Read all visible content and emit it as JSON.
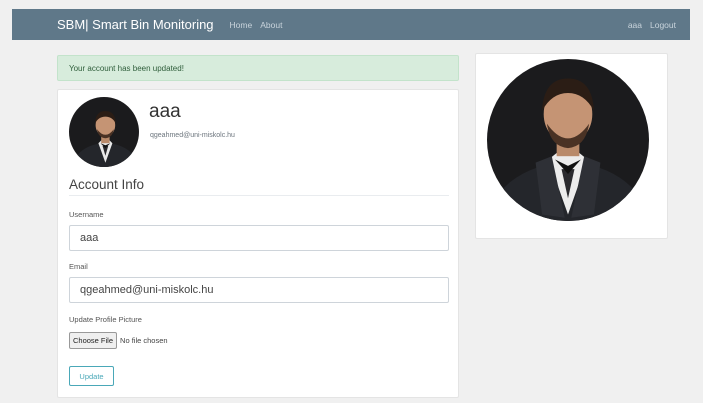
{
  "navbar": {
    "brand": "SBM| Smart Bin Monitoring",
    "links": [
      "Home",
      "About"
    ],
    "user": "aaa",
    "logout": "Logout"
  },
  "alert": {
    "message": "Your account has been updated!",
    "color": "#d7ecdc"
  },
  "profile": {
    "username": "aaa",
    "email": "qgeahmed@uni-miskolc.hu"
  },
  "form": {
    "legend": "Account Info",
    "username_label": "Username",
    "username_value": "aaa",
    "email_label": "Email",
    "email_value": "qgeahmed@uni-miskolc.hu",
    "picture_label": "Update Profile Picture",
    "choose_file": "Choose File",
    "file_status": "No file chosen",
    "submit": "Update"
  },
  "colors": {
    "navbar": "#5f7889",
    "accent": "#4aa8b8"
  },
  "icons": {
    "profile_photo": "profile-photo-icon"
  }
}
